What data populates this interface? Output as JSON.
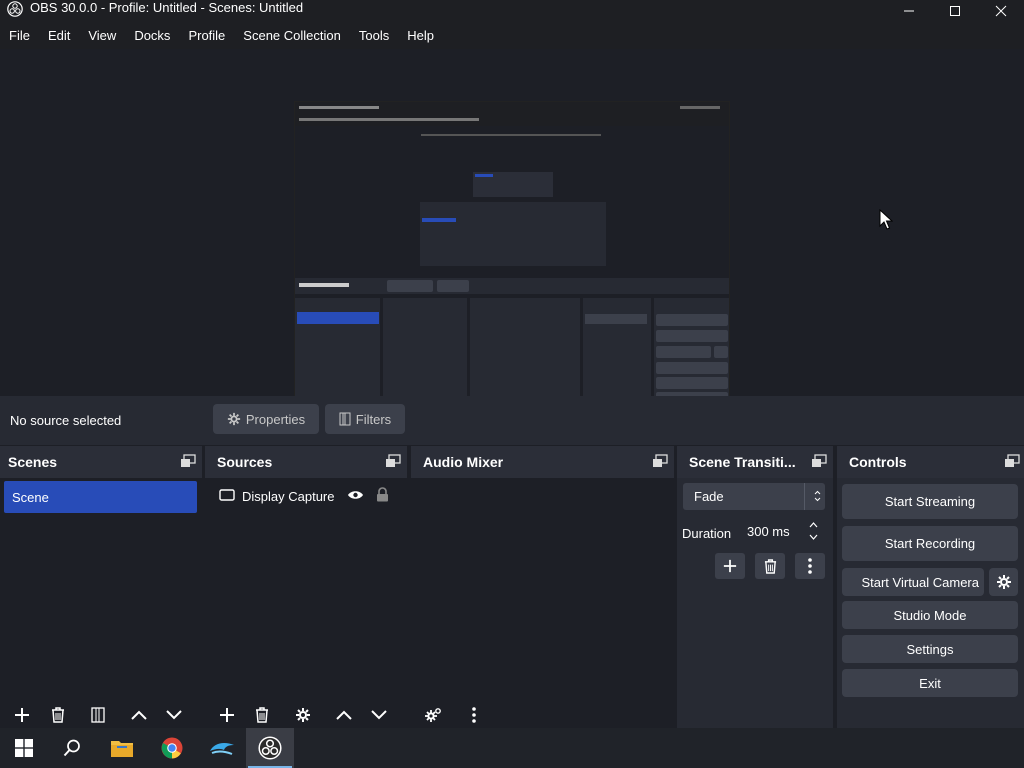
{
  "window": {
    "title": "OBS 30.0.0 - Profile: Untitled - Scenes: Untitled"
  },
  "menu": [
    "File",
    "Edit",
    "View",
    "Docks",
    "Profile",
    "Scene Collection",
    "Tools",
    "Help"
  ],
  "context_bar": {
    "status": "No source selected",
    "properties_label": "Properties",
    "filters_label": "Filters"
  },
  "docks": {
    "scenes": {
      "title": "Scenes",
      "items": [
        "Scene"
      ]
    },
    "sources": {
      "title": "Sources",
      "items": [
        {
          "label": "Display Capture",
          "visible": true,
          "locked": true
        }
      ]
    },
    "audio_mixer": {
      "title": "Audio Mixer"
    },
    "transitions": {
      "title": "Scene Transiti...",
      "transition": "Fade",
      "duration_label": "Duration",
      "duration_value": "300 ms"
    },
    "controls": {
      "title": "Controls",
      "start_streaming": "Start Streaming",
      "start_recording": "Start Recording",
      "start_virtual_camera": "Start Virtual Camera",
      "studio_mode": "Studio Mode",
      "settings": "Settings",
      "exit": "Exit"
    }
  },
  "colors": {
    "accent": "#284cb8",
    "panel": "#272a33",
    "body": "#1d1f26",
    "button": "#3c404b"
  },
  "taskbar": [
    "windows-start-icon",
    "search-icon",
    "file-explorer-icon",
    "chrome-icon",
    "dolphin-icon",
    "obs-icon"
  ]
}
